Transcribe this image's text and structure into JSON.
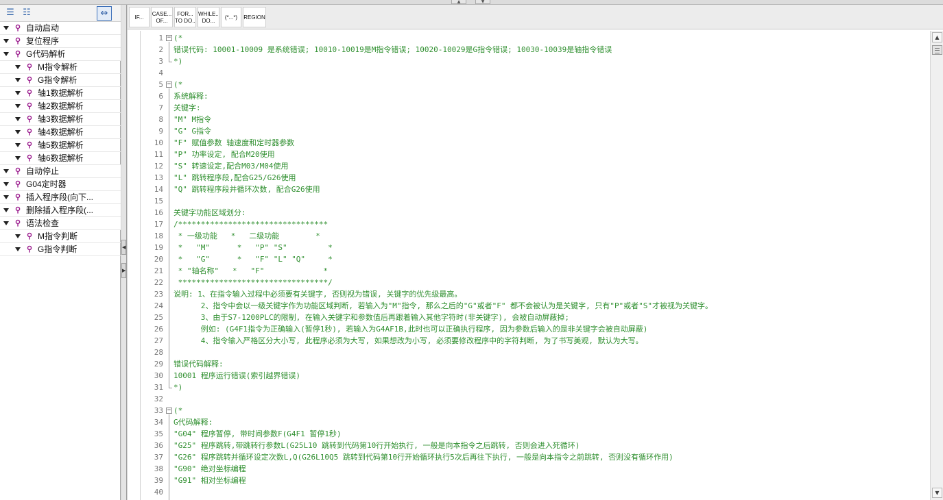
{
  "tree_toolbar": {
    "icons": [
      "collapse-all-icon",
      "expand-all-icon",
      "toggle-view-icon"
    ]
  },
  "tree": [
    {
      "label": "自动启动",
      "level": 0
    },
    {
      "label": "复位程序",
      "level": 0
    },
    {
      "label": "G代码解析",
      "level": 0
    },
    {
      "label": "M指令解析",
      "level": 1
    },
    {
      "label": "G指令解析",
      "level": 1
    },
    {
      "label": "轴1数据解析",
      "level": 1
    },
    {
      "label": "轴2数据解析",
      "level": 1
    },
    {
      "label": "轴3数据解析",
      "level": 1
    },
    {
      "label": "轴4数据解析",
      "level": 1
    },
    {
      "label": "轴5数据解析",
      "level": 1
    },
    {
      "label": "轴6数据解析",
      "level": 1
    },
    {
      "label": "自动停止",
      "level": 0
    },
    {
      "label": "G04定时器",
      "level": 0
    },
    {
      "label": "插入程序段(向下...",
      "level": 0
    },
    {
      "label": "删除插入程序段(...",
      "level": 0
    },
    {
      "label": "语法检查",
      "level": 0
    },
    {
      "label": "M指令判断",
      "level": 1
    },
    {
      "label": "G指令判断",
      "level": 1
    }
  ],
  "snippets": [
    "IF...",
    "CASE...\nOF...",
    "FOR...\nTO DO...",
    "WHILE...\nDO...",
    "(*...*)",
    "REGION"
  ],
  "code_lines": [
    {
      "n": "1",
      "fold": "start",
      "text": "(*"
    },
    {
      "n": "2",
      "fold": "",
      "text": "错误代码: 10001-10009 是系统错误; 10010-10019是M指令错误; 10020-10029是G指令错误; 10030-10039是轴指令错误"
    },
    {
      "n": "3",
      "fold": "end",
      "text": "*)"
    },
    {
      "n": "4",
      "fold": "",
      "text": ""
    },
    {
      "n": "5",
      "fold": "start",
      "text": "(*"
    },
    {
      "n": "6",
      "fold": "",
      "text": "系统解释:"
    },
    {
      "n": "7",
      "fold": "",
      "text": "关键字:"
    },
    {
      "n": "8",
      "fold": "",
      "text": "\"M\" M指令"
    },
    {
      "n": "9",
      "fold": "",
      "text": "\"G\" G指令"
    },
    {
      "n": "10",
      "fold": "",
      "text": "\"F\" 赋值参数 轴速度和定时器参数"
    },
    {
      "n": "11",
      "fold": "",
      "text": "\"P\" 功率设定, 配合M20使用"
    },
    {
      "n": "12",
      "fold": "",
      "text": "\"S\" 转速设定,配合M03/M04使用"
    },
    {
      "n": "13",
      "fold": "",
      "text": "\"L\" 跳转程序段,配合G25/G26使用"
    },
    {
      "n": "14",
      "fold": "",
      "text": "\"Q\" 跳转程序段并循环次数, 配合G26使用"
    },
    {
      "n": "15",
      "fold": "",
      "text": ""
    },
    {
      "n": "16",
      "fold": "",
      "text": "关键字功能区域划分:"
    },
    {
      "n": "17",
      "fold": "",
      "text": "/*********************************"
    },
    {
      "n": "18",
      "fold": "",
      "text": " * 一级功能   *   二级功能        *"
    },
    {
      "n": "19",
      "fold": "",
      "text": " *   \"M\"      *   \"P\" \"S\"         *"
    },
    {
      "n": "20",
      "fold": "",
      "text": " *   \"G\"      *   \"F\" \"L\" \"Q\"     *"
    },
    {
      "n": "21",
      "fold": "",
      "text": " * \"轴名称\"   *   \"F\"             *"
    },
    {
      "n": "22",
      "fold": "",
      "text": " *********************************/"
    },
    {
      "n": "23",
      "fold": "",
      "text": "说明: 1、在指令输入过程中必须要有关键字, 否则视为错误, 关键字的优先级最高。"
    },
    {
      "n": "24",
      "fold": "",
      "text": "      2、指令中会以一级关键字作为功能区域判断, 若输入为\"M\"指令, 那么之后的\"G\"或者\"F\" 都不会被认为是关键字, 只有\"P\"或者\"S\"才被视为关键字。"
    },
    {
      "n": "25",
      "fold": "",
      "text": "      3、由于S7-1200PLC的限制, 在输入关键字和参数值后再跟着输入其他字符时(非关键字), 会被自动屏蔽掉;"
    },
    {
      "n": "26",
      "fold": "",
      "text": "      例如: (G4F1指令为正确输入(暂停1秒), 若输入为G4AF1B,此时也可以正确执行程序, 因为参数后输入的是非关键字会被自动屏蔽)"
    },
    {
      "n": "27",
      "fold": "",
      "text": "      4、指令输入严格区分大小写, 此程序必须为大写, 如果想改为小写, 必须要修改程序中的字符判断, 为了书写美观, 默认为大写。"
    },
    {
      "n": "28",
      "fold": "",
      "text": ""
    },
    {
      "n": "29",
      "fold": "",
      "text": "错误代码解释:"
    },
    {
      "n": "30",
      "fold": "",
      "text": "10001 程序运行错误(索引越界错误)"
    },
    {
      "n": "31",
      "fold": "end",
      "text": "*)"
    },
    {
      "n": "32",
      "fold": "",
      "text": ""
    },
    {
      "n": "33",
      "fold": "start",
      "text": "(*"
    },
    {
      "n": "34",
      "fold": "",
      "text": "G代码解释:"
    },
    {
      "n": "35",
      "fold": "",
      "text": "\"G04\" 程序暂停, 带时间参数F(G4F1 暂停1秒)"
    },
    {
      "n": "36",
      "fold": "",
      "text": "\"G25\" 程序跳转,带跳转行参数L(G25L10 跳转到代码第10行开始执行, 一般是向本指令之后跳转, 否则会进入死循环)"
    },
    {
      "n": "37",
      "fold": "",
      "text": "\"G26\" 程序跳转并循环设定次数L,Q(G26L10Q5 跳转到代码第10行开始循环执行5次后再往下执行, 一般是向本指令之前跳转, 否则没有循环作用)"
    },
    {
      "n": "38",
      "fold": "",
      "text": "\"G90\" 绝对坐标编程"
    },
    {
      "n": "39",
      "fold": "",
      "text": "\"G91\" 相对坐标编程"
    },
    {
      "n": "40",
      "fold": "",
      "text": ""
    }
  ],
  "colors": {
    "comment": "#2f8f2f",
    "block_icon": "#9c1f8f",
    "line_number": "#777777"
  }
}
